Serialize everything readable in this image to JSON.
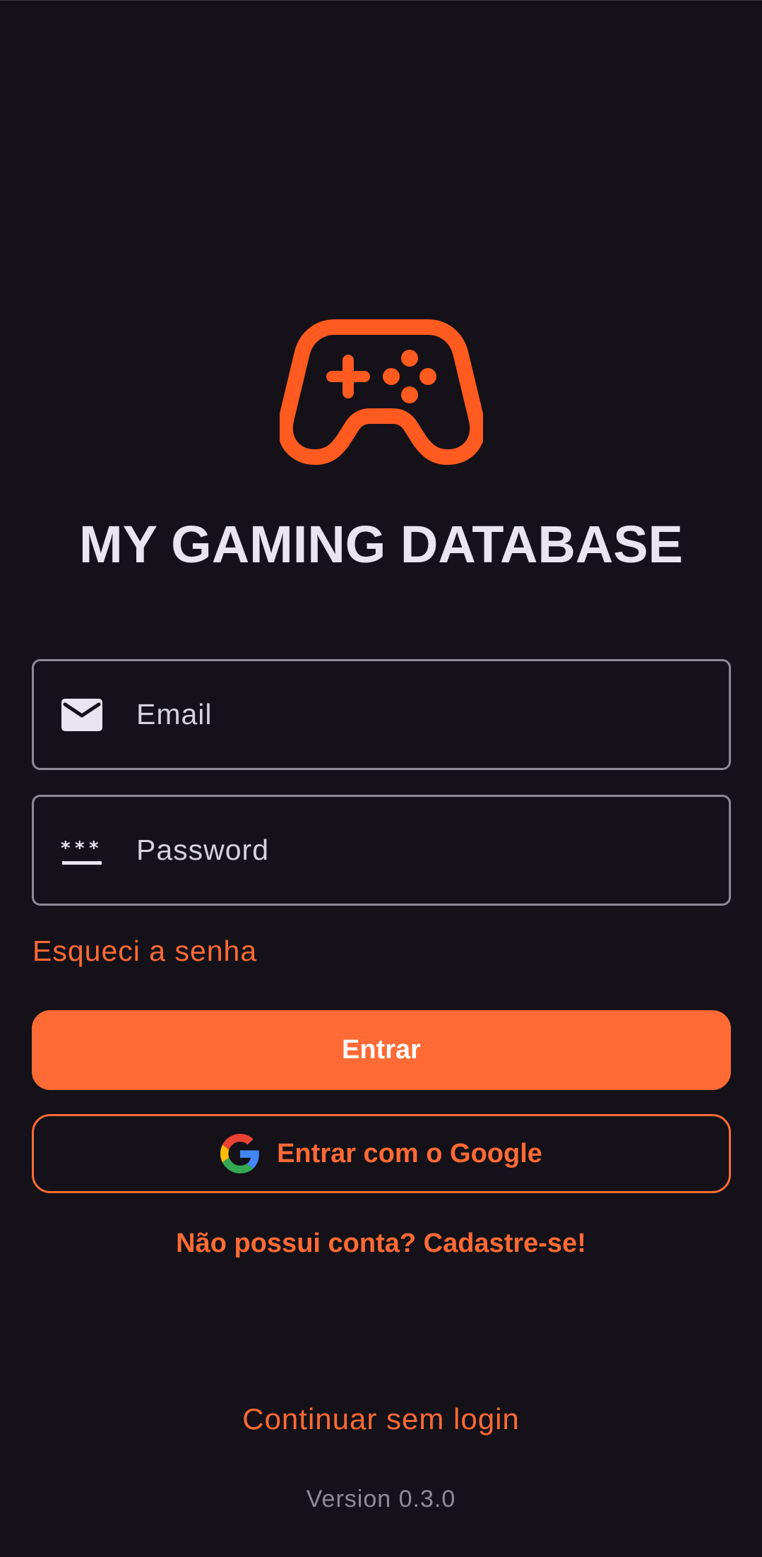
{
  "app": {
    "title": "MY GAMING DATABASE",
    "logo_icon": "gamepad-icon",
    "accent_color": "#ff6a35",
    "logo_color": "#ff5a1f",
    "background_color": "#141118"
  },
  "login_form": {
    "email": {
      "placeholder": "Email",
      "value": "",
      "icon": "email-icon"
    },
    "password": {
      "placeholder": "Password",
      "value": "",
      "icon": "password-icon"
    },
    "forgot_password_label": "Esqueci a senha",
    "submit_label": "Entrar",
    "google_label": "Entrar com o Google",
    "google_icon": "google-icon",
    "signup_label": "Não possui conta? Cadastre-se!"
  },
  "footer": {
    "guest_label": "Continuar sem login",
    "version_label": "Version 0.3.0"
  }
}
